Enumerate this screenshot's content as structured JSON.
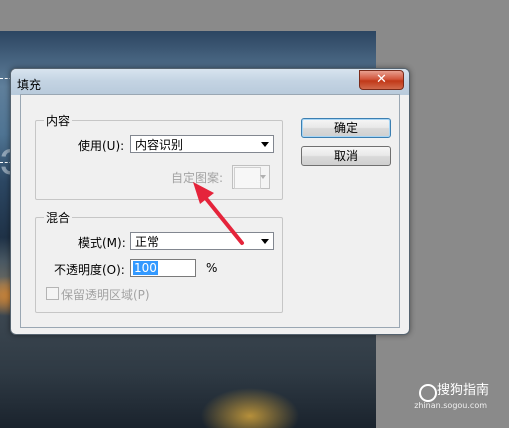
{
  "dialog": {
    "title": "填充",
    "close_glyph": "✕",
    "content_group": {
      "label": "内容",
      "use_label": "使用(U):",
      "use_value": "内容识别",
      "custom_pattern_label": "自定图案:"
    },
    "blend_group": {
      "label": "混合",
      "mode_label": "模式(M):",
      "mode_value": "正常",
      "opacity_label": "不透明度(O):",
      "opacity_value": "100",
      "opacity_unit": "%",
      "preserve_transparency_label": "保留透明区域(P)"
    },
    "ok_label": "确定",
    "cancel_label": "取消"
  },
  "watermark": {
    "text": "搜狗指南",
    "url": "zhinan.sogou.com"
  },
  "annotation_color": "#e5243b",
  "icons": [
    "close-icon",
    "chevron-down-icon",
    "red-arrow-annotation"
  ]
}
